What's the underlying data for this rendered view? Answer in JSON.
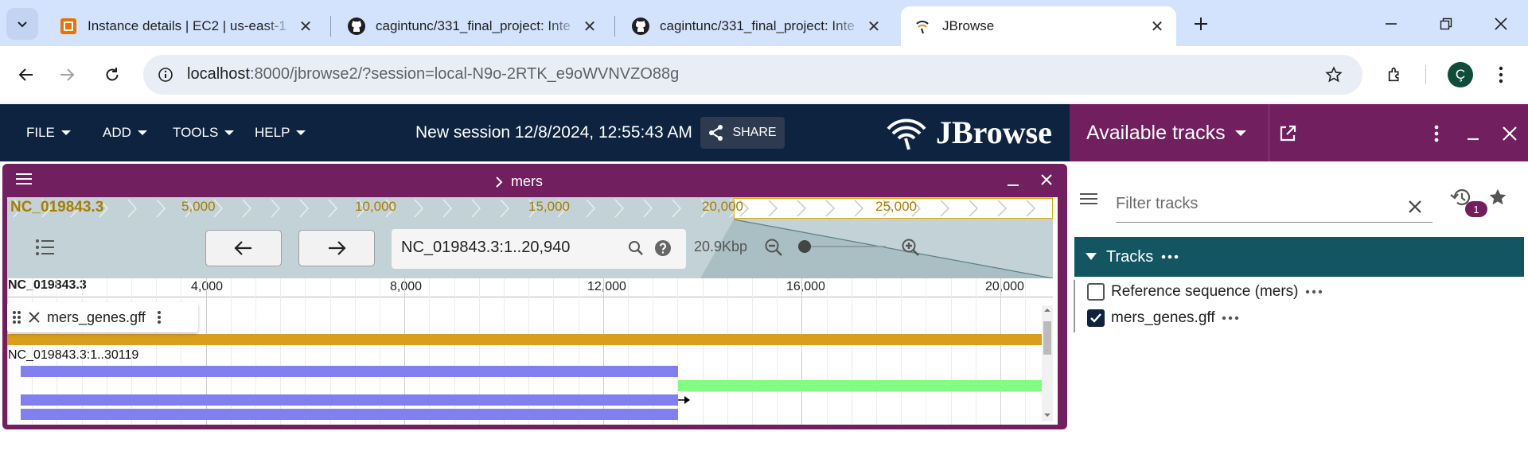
{
  "browser": {
    "tabs": [
      {
        "title": "Instance details | EC2 | us-east-1",
        "icon": "aws-ec2-icon"
      },
      {
        "title": "cagintunc/331_final_project: Inte",
        "icon": "github-icon"
      },
      {
        "title": "cagintunc/331_final_project: Inte",
        "icon": "github-icon"
      },
      {
        "title": "JBrowse",
        "icon": "jbrowse-icon",
        "active": true
      }
    ],
    "url_host": "localhost",
    "url_rest": ":8000/jbrowse2/?session=local-N9o-2RTK_e9oWVNVZO88g",
    "profile_initial": "Ç"
  },
  "jbrowse": {
    "menus": [
      "FILE",
      "ADD",
      "TOOLS",
      "HELP"
    ],
    "session_name": "New session 12/8/2024, 12:55:43 AM",
    "share_label": "SHARE",
    "logo_text": "JBrowse",
    "view": {
      "assembly": "mers",
      "overview": {
        "refname": "NC_019843.3",
        "ticks": [
          "5,000",
          "10,000",
          "15,000",
          "20,000",
          "25,000"
        ]
      },
      "locstring": "NC_019843.3:1..20,940",
      "bp_count": "20.9Kbp",
      "ruler": {
        "refname": "NC_019843.3",
        "ticks": [
          "4,000",
          "8,000",
          "12,000",
          "16,000",
          "20,000"
        ]
      },
      "track": {
        "name": "mers_genes.gff",
        "feature_label": "NC_019843.3:1..30119"
      }
    }
  },
  "drawer": {
    "title": "Available tracks",
    "filter_placeholder": "Filter tracks",
    "history_count": "1",
    "category": "Tracks",
    "tracks": [
      {
        "label": "Reference sequence (mers)",
        "checked": false
      },
      {
        "label": "mers_genes.gff",
        "checked": true
      }
    ]
  },
  "colors": {
    "header": "#0d233f",
    "drawer": "#711f5f",
    "tracks_bar": "#135560",
    "gene": "#d99e1b",
    "cds": "#8080f0",
    "utr": "#80ff80"
  }
}
